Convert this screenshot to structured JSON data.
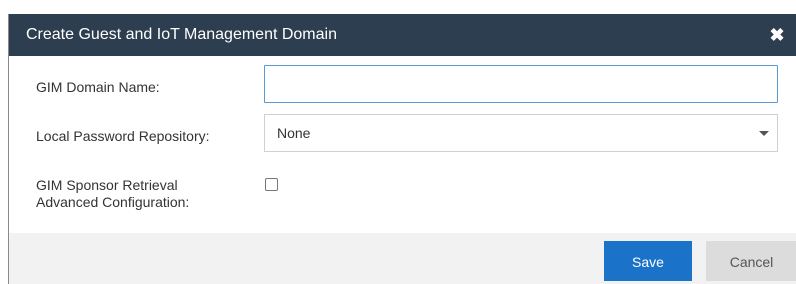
{
  "dialog": {
    "title": "Create Guest and IoT Management Domain",
    "close_icon": "close-icon"
  },
  "form": {
    "domain_name_label": "GIM Domain Name:",
    "domain_name_value": "",
    "password_repo_label": "Local Password Repository:",
    "password_repo_selected": "None",
    "sponsor_label_line1": "GIM Sponsor Retrieval",
    "sponsor_label_line2": "Advanced Configuration:",
    "sponsor_checked": false
  },
  "buttons": {
    "save": "Save",
    "cancel": "Cancel"
  },
  "colors": {
    "titlebar": "#2c3e50",
    "save": "#1a73c8",
    "cancel": "#dcdcdc",
    "input_focus_border": "#5b9bd5"
  }
}
